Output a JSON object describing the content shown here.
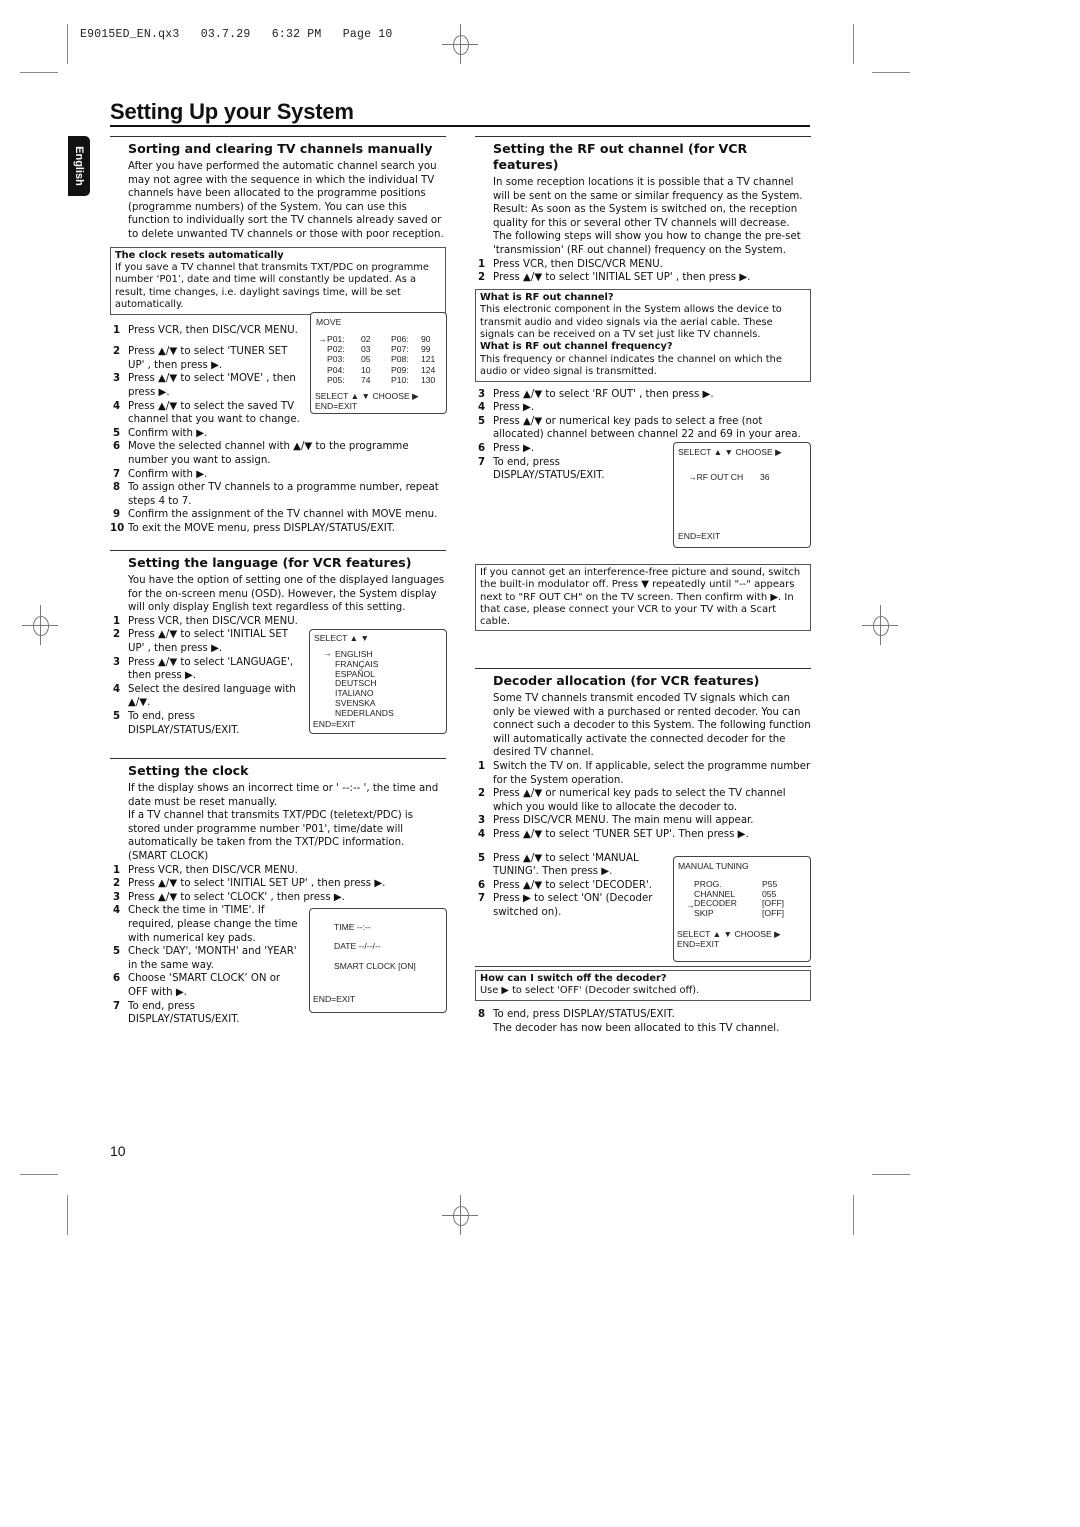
{
  "slug": {
    "file": "E9015ED_EN.qx3",
    "date": "03.7.29",
    "time": "6:32 PM",
    "page": "Page 10"
  },
  "page_title": "Setting Up your System",
  "language_tab": "English",
  "page_number": "10",
  "sorting": {
    "heading": "Sorting and clearing TV channels manually",
    "intro": "After you have performed the automatic channel search you may not agree with the sequence in which the individual TV channels have been allocated to the programme positions (programme numbers) of the System. You can use this function to individually sort the TV channels already saved or to delete unwanted TV channels or those with poor reception.",
    "note_title": "The clock resets automatically",
    "note_body": "If you save a TV channel that transmits TXT/PDC on programme number ‘P01’, date and time will constantly be updated. As a result, time changes, i.e. daylight savings time, will be set automatically.",
    "steps": [
      {
        "n": "1",
        "text": "Press VCR, then DISC/VCR MENU."
      },
      {
        "n": "2",
        "text": "Press ▲/▼ to select 'TUNER SET UP' , then press ▶."
      },
      {
        "n": "3",
        "text": "Press ▲/▼ to select 'MOVE' , then press ▶."
      },
      {
        "n": "4",
        "text": "Press ▲/▼ to select the saved TV channel that you want to change."
      },
      {
        "n": "5",
        "text": "Confirm with ▶."
      },
      {
        "n": "6",
        "text": "Move the selected channel with ▲/▼ to the programme number you want to assign."
      },
      {
        "n": "7",
        "text": "Confirm with ▶."
      },
      {
        "n": "8",
        "text": "To assign other TV channels to a programme number, repeat steps 4 to 7."
      },
      {
        "n": "9",
        "text": "Confirm the assignment of the TV channel with MOVE menu."
      },
      {
        "n": "10",
        "text": "To exit the MOVE menu, press DISPLAY/STATUS/EXIT."
      }
    ],
    "osd": {
      "title": "MOVE",
      "arrow": "→",
      "left": [
        [
          "P01:",
          "02"
        ],
        [
          "P02:",
          "03"
        ],
        [
          "P03:",
          "05"
        ],
        [
          "P04:",
          "10"
        ],
        [
          "P05:",
          "74"
        ]
      ],
      "right": [
        [
          "P06:",
          "90"
        ],
        [
          "P07:",
          "99"
        ],
        [
          "P08:",
          "121"
        ],
        [
          "P09:",
          "124"
        ],
        [
          "P10:",
          "130"
        ]
      ],
      "footer1": "SELECT ▲ ▼  CHOOSE ▶",
      "footer2": "END=EXIT"
    }
  },
  "language": {
    "heading": "Setting the language (for VCR features)",
    "intro": "You have the option of setting one of the displayed languages for the on-screen menu (OSD). However, the System display will only display English text regardless of this setting.",
    "steps": [
      {
        "n": "1",
        "text": "Press VCR, then DISC/VCR MENU."
      },
      {
        "n": "2",
        "text": "Press ▲/▼ to select 'INITIAL SET UP' , then press ▶."
      },
      {
        "n": "3",
        "text": "Press ▲/▼ to select 'LANGUAGE', then press ▶."
      },
      {
        "n": "4",
        "text": "Select the desired language with ▲/▼."
      },
      {
        "n": "5",
        "text": "To end, press DISPLAY/STATUS/EXIT."
      }
    ],
    "osd": {
      "title": "SELECT ▲ ▼",
      "arrow": "→",
      "options": [
        "ENGLISH",
        "FRANÇAIS",
        "ESPAÑOL",
        "DEUTSCH",
        "ITALIANO",
        "SVENSKA",
        "NEDERLANDS"
      ],
      "footer": "END=EXIT"
    }
  },
  "clock": {
    "heading": "Setting the clock",
    "intro1": "If the display shows an incorrect time or ' --:-- ', the time and date must be reset manually.",
    "intro2": "If a TV channel that transmits TXT/PDC (teletext/PDC) is stored under programme number 'P01', time/date will automatically be taken from the TXT/PDC information. (SMART CLOCK)",
    "steps": [
      {
        "n": "1",
        "text": "Press VCR, then DISC/VCR MENU."
      },
      {
        "n": "2",
        "text": "Press ▲/▼ to select 'INITIAL SET UP' , then press ▶."
      },
      {
        "n": "3",
        "text": "Press ▲/▼ to select 'CLOCK' , then press ▶."
      },
      {
        "n": "4",
        "text": "Check the time in 'TIME'. If required, please change the time with numerical key pads."
      },
      {
        "n": "5",
        "text": "Check 'DAY', 'MONTH' and 'YEAR' in the same way."
      },
      {
        "n": "6",
        "text": "Choose ‘SMART CLOCK’ ON or OFF with ▶."
      },
      {
        "n": "7",
        "text": "To end, press DISPLAY/STATUS/EXIT."
      }
    ],
    "osd": {
      "time": "TIME --:--",
      "date": "DATE --/--/--",
      "smart": "SMART CLOCK [ON]",
      "footer": "END=EXIT"
    }
  },
  "rf": {
    "heading": "Setting the RF out channel (for VCR features)",
    "intro": "In some reception locations it is possible that a TV channel will be sent on the same or similar frequency as the System. Result: As soon as the System is switched on, the reception quality for this or several other TV channels will decrease. The following steps will show you how to change the pre-set 'transmission' (RF out channel) frequency on the System.",
    "steps_a": [
      {
        "n": "1",
        "text": "Press VCR, then DISC/VCR MENU."
      },
      {
        "n": "2",
        "text": "Press ▲/▼ to select 'INITIAL SET UP' , then press ▶."
      }
    ],
    "note_q1": "What is RF out channel?",
    "note_a1": "This electronic component in the System allows the device to transmit audio and video signals via the aerial cable. These signals can be received on a TV set just like TV channels.",
    "note_q2": "What is RF out channel frequency?",
    "note_a2": "This frequency or channel indicates the channel on which the audio or video signal is transmitted.",
    "steps_b": [
      {
        "n": "3",
        "text": "Press ▲/▼ to select 'RF OUT' , then press ▶."
      },
      {
        "n": "4",
        "text": "Press ▶."
      },
      {
        "n": "5",
        "text": "Press ▲/▼ or numerical key pads to select a free (not allocated) channel between channel 22 and 69 in your area."
      },
      {
        "n": "6",
        "text": "Press ▶."
      },
      {
        "n": "7",
        "text": "To end, press DISPLAY/STATUS/EXIT."
      }
    ],
    "osd": {
      "header": "SELECT ▲ ▼  CHOOSE ▶",
      "row": "→RF OUT CH",
      "value": "36",
      "footer": "END=EXIT"
    },
    "tip": "If you cannot get an interference-free picture and sound, switch the built-in modulator off. Press ▼ repeatedly until \"--\" appears next to \"RF OUT CH\" on the TV screen. Then confirm with ▶. In that case, please connect your VCR to your TV with a Scart cable."
  },
  "decoder": {
    "heading": "Decoder allocation (for VCR features)",
    "intro": "Some TV channels transmit encoded TV signals which can only be viewed with a purchased or rented decoder. You can connect such a decoder to this System. The following function will automatically activate the connected decoder for the desired TV channel.",
    "steps_a": [
      {
        "n": "1",
        "text": "Switch the TV on. If applicable, select the programme number for the System operation."
      },
      {
        "n": "2",
        "text": "Press ▲/▼ or numerical key pads to select the TV channel which you would like to allocate the decoder to."
      },
      {
        "n": "3",
        "text": "Press DISC/VCR MENU. The main menu will appear."
      },
      {
        "n": "4",
        "text": "Press ▲/▼ to select 'TUNER SET UP'. Then press ▶."
      },
      {
        "n": "5",
        "text": "Press ▲/▼ to select 'MANUAL TUNING'. Then press ▶."
      },
      {
        "n": "6",
        "text": "Press ▲/▼ to select 'DECODER'."
      },
      {
        "n": "7",
        "text": "Press ▶ to select 'ON' (Decoder switched on)."
      }
    ],
    "osd": {
      "title": "MANUAL TUNING",
      "rows": [
        [
          "PROG.",
          "P55"
        ],
        [
          "CHANNEL",
          "055"
        ],
        [
          "DECODER",
          "[OFF]"
        ],
        [
          "SKIP",
          "[OFF]"
        ]
      ],
      "arrow": "→",
      "footer1": "SELECT ▲ ▼  CHOOSE ▶",
      "footer2": "END=EXIT"
    },
    "note_q": "How can I switch off the decoder?",
    "note_a": "Use ▶ to select 'OFF' (Decoder switched off).",
    "steps_b": [
      {
        "n": "8",
        "text": "To end, press DISPLAY/STATUS/EXIT."
      }
    ],
    "final": "The decoder has now been allocated to this TV channel."
  }
}
